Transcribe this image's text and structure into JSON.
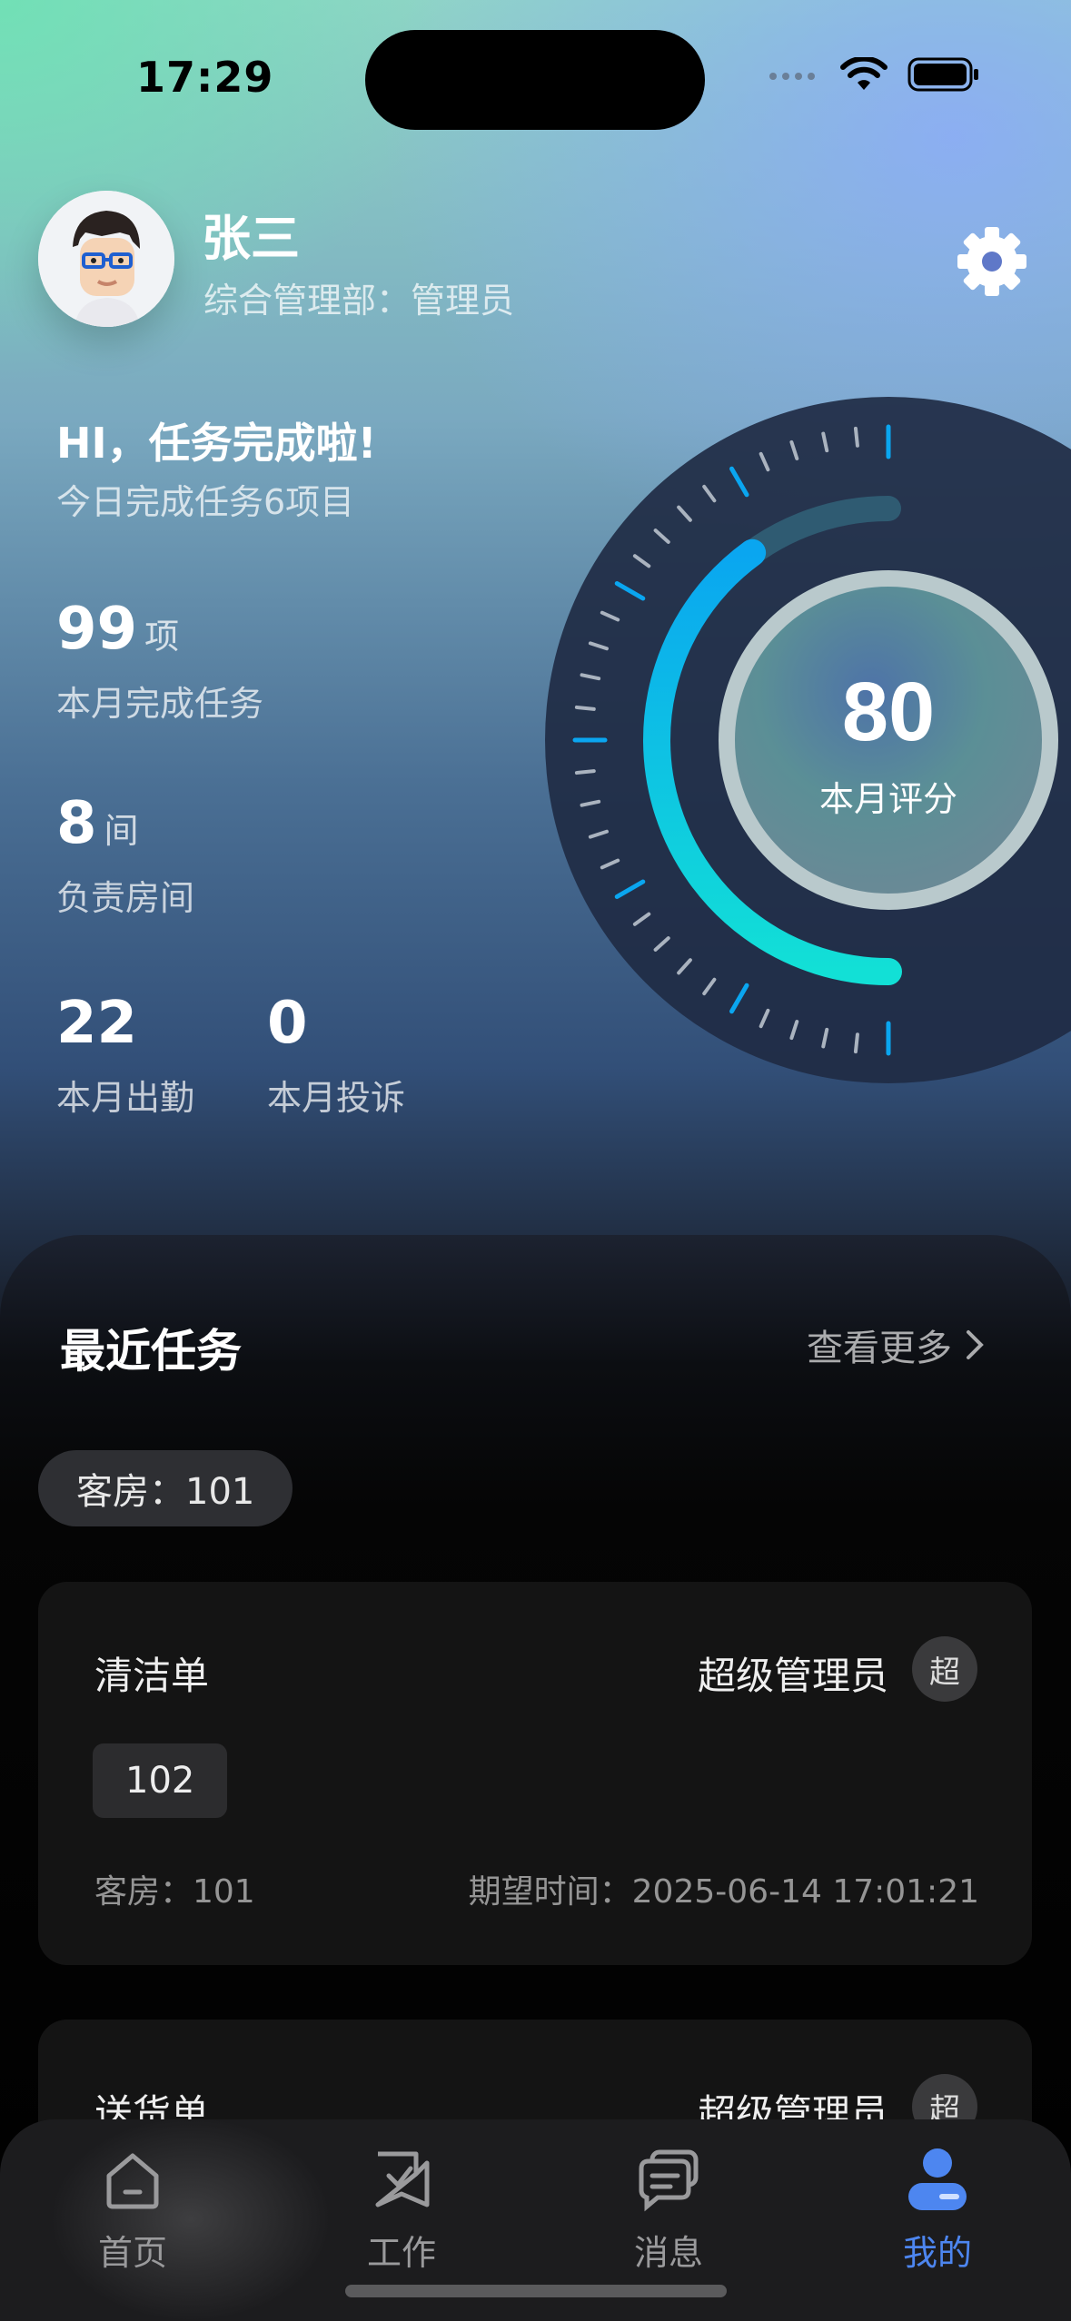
{
  "status_bar": {
    "time": "17:29"
  },
  "profile": {
    "name": "张三",
    "department": "综合管理部：管理员"
  },
  "greeting": {
    "title": "HI，任务完成啦!",
    "subtitle": "今日完成任务6项目"
  },
  "stats": {
    "monthly_tasks": {
      "value": "99",
      "unit": "项",
      "label": "本月完成任务"
    },
    "rooms": {
      "value": "8",
      "unit": "间",
      "label": "负责房间"
    },
    "attendance": {
      "value": "22",
      "label": "本月出勤"
    },
    "complaints": {
      "value": "0",
      "label": "本月投诉"
    }
  },
  "score": {
    "value": "80",
    "label": "本月评分",
    "progress": 0.8
  },
  "recent": {
    "title": "最近任务",
    "more_label": "查看更多",
    "filter_chip": "客房：101"
  },
  "tasks": [
    {
      "title": "清洁单",
      "assignee": "超级管理员",
      "badge": "超",
      "room_tag": "102",
      "room": "客房：101",
      "expected": "期望时间：2025-06-14 17:01:21"
    },
    {
      "title": "送货单",
      "assignee": "超级管理员",
      "badge": "超"
    }
  ],
  "tabs": [
    {
      "label": "首页",
      "icon": "home-icon"
    },
    {
      "label": "工作",
      "icon": "work-icon"
    },
    {
      "label": "消息",
      "icon": "message-icon"
    },
    {
      "label": "我的",
      "icon": "profile-icon",
      "active": true
    }
  ],
  "colors": {
    "accent": "#4d86f0",
    "gauge_cyan": "#00c2e8",
    "gauge_blue": "#0aa6f0"
  }
}
